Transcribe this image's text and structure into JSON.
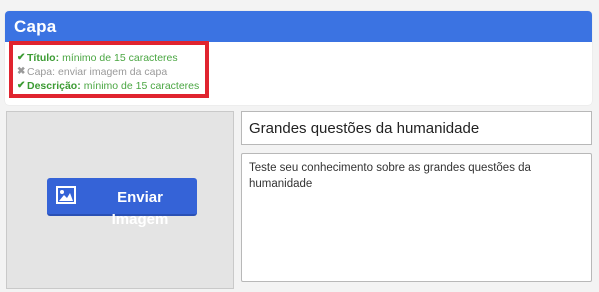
{
  "panel": {
    "title": "Capa",
    "checklist": [
      {
        "status": "ok",
        "label": "Título:",
        "value": "mínimo de 15 caracteres"
      },
      {
        "status": "missing",
        "label": "Capa:",
        "value": "enviar imagem da capa"
      },
      {
        "status": "ok",
        "label": "Descrição:",
        "value": "mínimo de 15 caracteres"
      }
    ],
    "check_icons": {
      "ok": "checkmark-icon",
      "missing": "cross-icon"
    }
  },
  "upload": {
    "button_label": "Enviar Imagem",
    "icon": "image-icon"
  },
  "form": {
    "title_value": "Grandes questões da humanidade",
    "description_value": "Teste seu conhecimento sobre as grandes questões da humanidade"
  },
  "colors": {
    "header": "#3b73e2",
    "highlight_border": "#e0242f",
    "ok": "#3c9b33",
    "missing": "#9a9a9a",
    "button": "#3563d7"
  }
}
